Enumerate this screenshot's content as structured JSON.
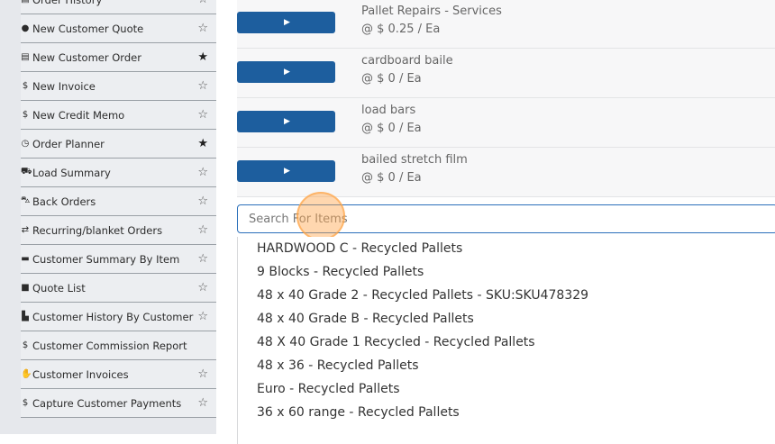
{
  "sidebar": {
    "items": [
      {
        "label": "Order History",
        "icon": "document-icon",
        "glyph": "▤",
        "starred": false
      },
      {
        "label": "New Customer Quote",
        "icon": "chat-icon",
        "glyph": "●",
        "starred": false
      },
      {
        "label": "New Customer Order",
        "icon": "list-icon",
        "glyph": "▤",
        "starred": true
      },
      {
        "label": "New Invoice",
        "icon": "dollar-icon",
        "glyph": "$",
        "starred": false
      },
      {
        "label": "New Credit Memo",
        "icon": "dollar-icon",
        "glyph": "$",
        "starred": false
      },
      {
        "label": "Order Planner",
        "icon": "clock-icon",
        "glyph": "◷",
        "starred": true
      },
      {
        "label": "Load Summary",
        "icon": "truck-icon",
        "glyph": "⛟",
        "starred": false
      },
      {
        "label": "Back Orders",
        "icon": "cart-icon",
        "glyph": "⛍",
        "starred": false
      },
      {
        "label": "Recurring/blanket Orders",
        "icon": "refresh-icon",
        "glyph": "⇄",
        "starred": false
      },
      {
        "label": "Customer Summary By Item",
        "icon": "grid-icon",
        "glyph": "▬",
        "starred": false
      },
      {
        "label": "Quote List",
        "icon": "comment-icon",
        "glyph": "■",
        "starred": false
      },
      {
        "label": "Customer History By Customer",
        "icon": "chart-icon",
        "glyph": "▙",
        "starred": false
      },
      {
        "label": "Customer Commission Report",
        "icon": "dollar-icon",
        "glyph": "$",
        "starred": null
      },
      {
        "label": "Customer Invoices",
        "icon": "hand-icon",
        "glyph": "✋",
        "starred": false
      },
      {
        "label": "Capture Customer Payments",
        "icon": "dollar-icon",
        "glyph": "$",
        "starred": false
      }
    ]
  },
  "products": [
    {
      "name": "Pallet Repairs - Services",
      "price": "@ $ 0.25 / Ea",
      "button_icon": "caret-right-icon"
    },
    {
      "name": "cardboard baile",
      "price": "@ $ 0 / Ea",
      "button_icon": "caret-right-icon"
    },
    {
      "name": "load bars",
      "price": "@ $ 0 / Ea",
      "button_icon": "caret-right-icon"
    },
    {
      "name": "bailed stretch film",
      "price": "@ $ 0 / Ea",
      "button_icon": "caret-right-icon"
    }
  ],
  "search": {
    "placeholder": "Search For Items",
    "value": ""
  },
  "dropdown": {
    "options": [
      "HARDWOOD C - Recycled Pallets",
      "9 Blocks - Recycled Pallets",
      "48 x 40 Grade 2 - Recycled Pallets - SKU:SKU478329",
      "48 x 40 Grade B - Recycled Pallets",
      "48 X 40 Grade 1 Recycled - Recycled Pallets",
      "48 x 36 - Recycled Pallets",
      "Euro - Recycled Pallets",
      "36 x 60 range - Recycled Pallets"
    ]
  },
  "colors": {
    "accent": "#1d5e9e",
    "search_border": "#2a6fba",
    "highlight": "#ffa64d"
  }
}
